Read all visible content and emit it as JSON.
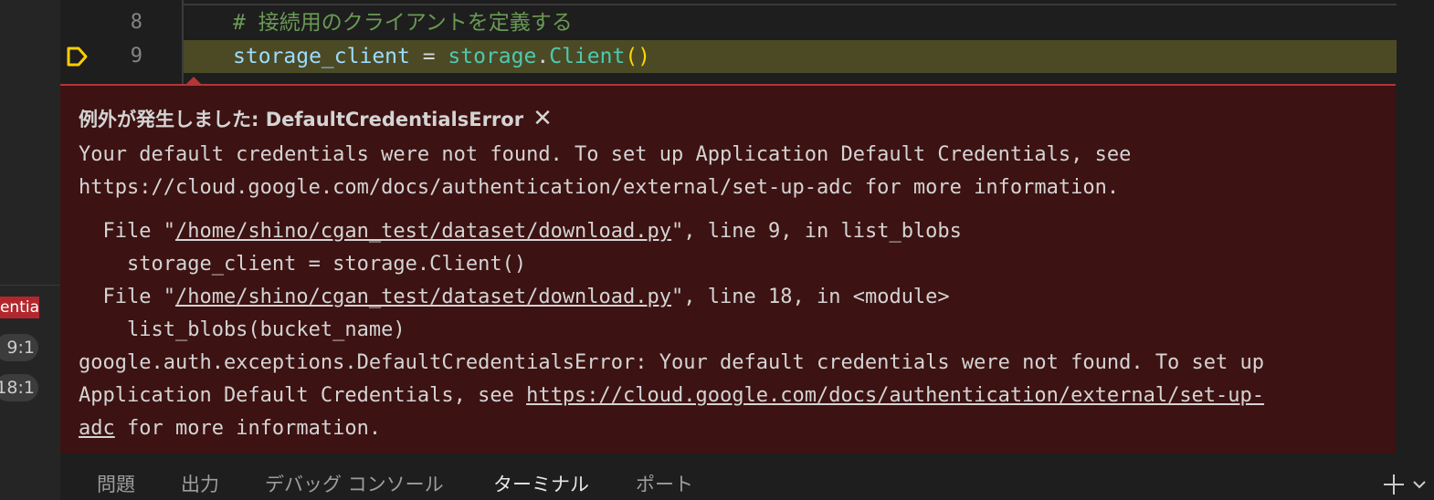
{
  "sidebar": {
    "exception_tag": "DefaultCredentia...",
    "badges": [
      "9:1",
      "18:1"
    ]
  },
  "editor": {
    "line8": {
      "number": "8",
      "comment": "# 接続用のクライアントを定義する"
    },
    "line9": {
      "number": "9",
      "var": "storage_client",
      "op": " = ",
      "module": "storage",
      "dot": ".",
      "cls": "Client",
      "parens": "()"
    }
  },
  "exception": {
    "title": "例外が発生しました: DefaultCredentialsError",
    "close_glyph": "✕",
    "message_line1": "Your default credentials were not found. To set up Application Default Credentials, see",
    "message_line2": "https://cloud.google.com/docs/authentication/external/set-up-adc for more information.",
    "trace": [
      {
        "prefix": "  File \"",
        "path": "/home/shino/cgan_test/dataset/download.py",
        "suffix": "\", line 9, in list_blobs"
      },
      {
        "code": "    storage_client = storage.Client()"
      },
      {
        "prefix": "  File \"",
        "path": "/home/shino/cgan_test/dataset/download.py",
        "suffix": "\", line 18, in <module>"
      },
      {
        "code": "    list_blobs(bucket_name)"
      }
    ],
    "final_line1": "google.auth.exceptions.DefaultCredentialsError: Your default credentials were not found. To set up",
    "final_line2_prefix": "Application Default Credentials, see ",
    "final_line2_link": "https://cloud.google.com/docs/authentication/external/set-up-",
    "final_line3_link": "adc",
    "final_line3_suffix": " for more information."
  },
  "panel": {
    "tabs": [
      "問題",
      "出力",
      "デバッグ コンソール",
      "ターミナル",
      "ポート"
    ],
    "active_tab": "ターミナル"
  },
  "colors": {
    "exception_bg": "#3d1212",
    "exception_border": "#b43535",
    "current_line": "#4b4a25",
    "breakpoint": "#ffcc00"
  }
}
